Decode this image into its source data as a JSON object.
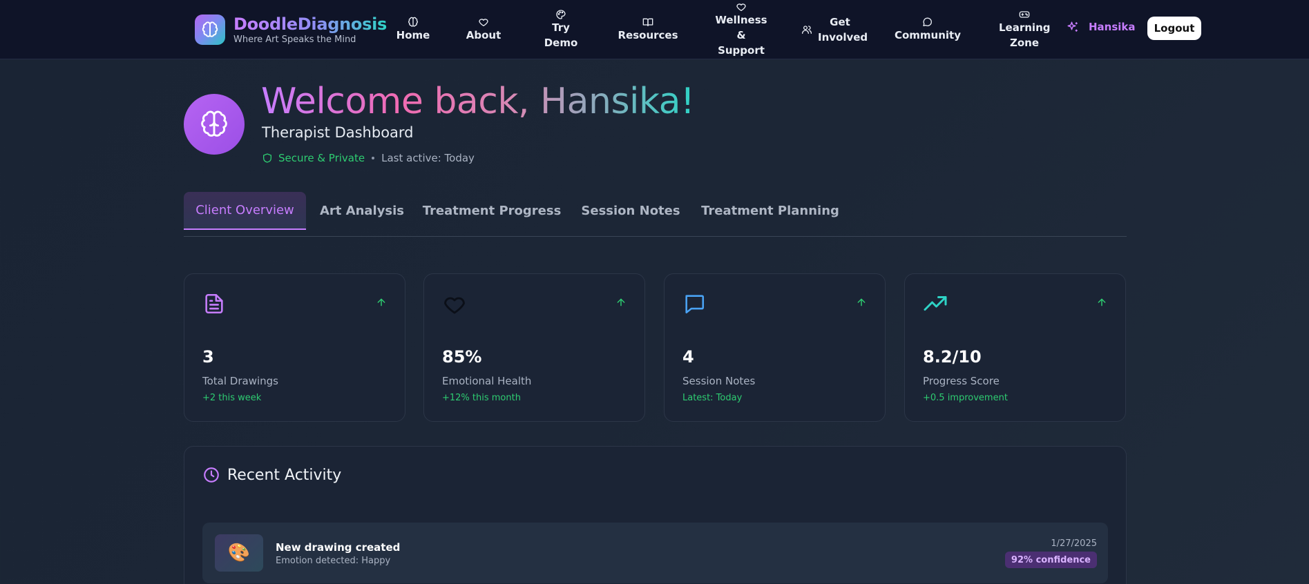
{
  "brand": {
    "name": "DoodleDiagnosis",
    "tagline": "Where Art Speaks the Mind"
  },
  "nav": {
    "items": [
      {
        "label": "Home",
        "icon": "brain-icon"
      },
      {
        "label": "About",
        "icon": "heart-icon"
      },
      {
        "label": "Try Demo",
        "icon": "palette-icon"
      },
      {
        "label": "Resources",
        "icon": "book-icon"
      },
      {
        "label": "Wellness & Support",
        "icon": "heart-icon"
      },
      {
        "label": "Get Involved",
        "icon": "users-icon"
      },
      {
        "label": "Community",
        "icon": "message-icon"
      },
      {
        "label": "Learning Zone",
        "icon": "gamepad-icon"
      }
    ],
    "user": "Hansika",
    "logout": "Logout"
  },
  "hero": {
    "welcome": "Welcome back, Hansika!",
    "subtitle": "Therapist Dashboard",
    "secure": "Secure & Private",
    "last_active": "Last active: Today"
  },
  "tabs": [
    {
      "label": "Client Overview",
      "active": true
    },
    {
      "label": "Art Analysis",
      "active": false
    },
    {
      "label": "Treatment Progress",
      "active": false
    },
    {
      "label": "Session Notes",
      "active": false
    },
    {
      "label": "Treatment Planning",
      "active": false
    }
  ],
  "stats": [
    {
      "icon": "document-icon",
      "value": "3",
      "label": "Total Drawings",
      "delta": "+2 this week",
      "color": "#c77dff"
    },
    {
      "icon": "heart-icon",
      "value": "85%",
      "label": "Emotional Health",
      "delta": "+12% this month",
      "color": "#0b0f18"
    },
    {
      "icon": "message-icon",
      "value": "4",
      "label": "Session Notes",
      "delta": "Latest: Today",
      "color": "#4aa3f5"
    },
    {
      "icon": "trending-up-icon",
      "value": "8.2/10",
      "label": "Progress Score",
      "delta": "+0.5 improvement",
      "color": "#2ed3c6"
    }
  ],
  "recent": {
    "title": "Recent Activity",
    "items": [
      {
        "icon": "palette-emoji",
        "title": "New drawing created",
        "subtitle": "Emotion detected: Happy",
        "date": "1/27/2025",
        "badge": "92% confidence"
      }
    ]
  },
  "colors": {
    "accent": "#c77dff",
    "success": "#2ecc71",
    "teal": "#2ed3c6",
    "nav_bg": "#0f1428"
  }
}
